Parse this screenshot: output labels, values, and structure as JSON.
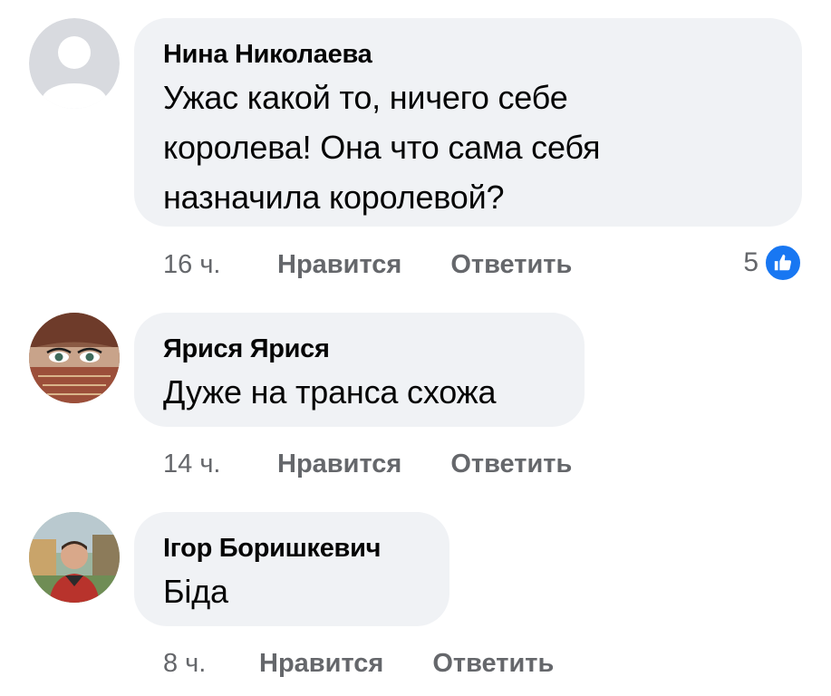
{
  "comments": [
    {
      "author": "Нина Николаева",
      "text": "Ужас какой то, ничего себе королева! Она что  сама себя назначила королевой?",
      "time": "16 ч.",
      "like_label": "Нравится",
      "reply_label": "Ответить",
      "reaction_count": "5",
      "reaction_icon": "thumbs-up-icon"
    },
    {
      "author": "Ярися Ярися",
      "text": "Дуже на транса схожа",
      "time": "14 ч.",
      "like_label": "Нравится",
      "reply_label": "Ответить"
    },
    {
      "author": "Ігор Боришкевич",
      "text": "Біда",
      "time": "8 ч.",
      "like_label": "Нравится",
      "reply_label": "Ответить"
    }
  ],
  "colors": {
    "bubble": "#f0f2f5",
    "secondary_text": "#65676b",
    "like_blue": "#1877f2"
  }
}
